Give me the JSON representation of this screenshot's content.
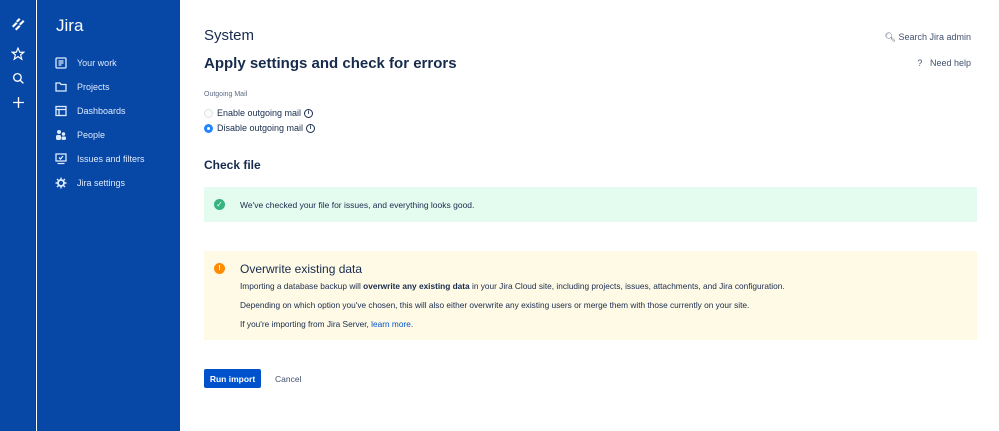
{
  "app": {
    "name": "Jira"
  },
  "nav": [
    {
      "label": "Your work",
      "icon": "your-work-icon"
    },
    {
      "label": "Projects",
      "icon": "folder-icon"
    },
    {
      "label": "Dashboards",
      "icon": "dashboard-icon"
    },
    {
      "label": "People",
      "icon": "people-icon"
    },
    {
      "label": "Issues and filters",
      "icon": "issues-icon"
    },
    {
      "label": "Jira settings",
      "icon": "gear-icon"
    }
  ],
  "header": {
    "section": "System",
    "title": "Apply settings and check for errors",
    "search": "Search Jira admin",
    "help": "Need help"
  },
  "mail": {
    "label": "Outgoing Mail",
    "options": [
      "Enable outgoing mail",
      "Disable outgoing mail"
    ],
    "selected": "Disable outgoing mail"
  },
  "check": {
    "title": "Check file",
    "message": "We've checked your file for issues, and everything looks good."
  },
  "warning": {
    "title": "Overwrite existing data",
    "p1_pre": "Importing a database backup will ",
    "p1_bold": "overwrite any existing data",
    "p1_post": " in your Jira Cloud site, including projects, issues, attachments, and Jira configuration.",
    "p2": "Depending on which option you've chosen, this will also either overwrite any existing users or merge them with those currently on your site.",
    "p3_pre": "If you're importing from Jira Server, ",
    "p3_link": "learn more",
    "p3_post": "."
  },
  "actions": {
    "run": "Run import",
    "cancel": "Cancel"
  }
}
